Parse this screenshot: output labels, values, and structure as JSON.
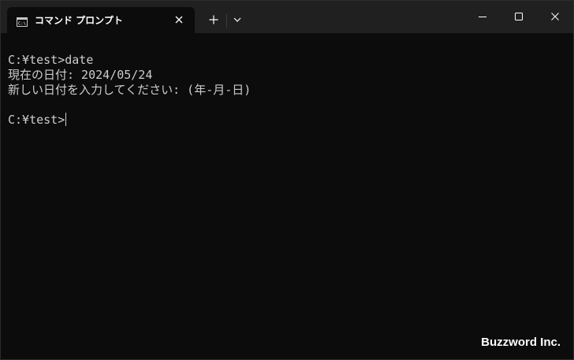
{
  "tab": {
    "title": "コマンド プロンプト"
  },
  "terminal": {
    "lines": [
      "C:¥test>date",
      "現在の日付: 2024/05/24",
      "新しい日付を入力してください: (年-月-日)",
      "",
      "C:¥test>"
    ]
  },
  "watermark": "Buzzword Inc.",
  "icons": {
    "tab_icon": "cmd-icon",
    "tab_close": "close-icon",
    "new_tab": "plus-icon",
    "dropdown": "chevron-down-icon",
    "minimize": "minimize-icon",
    "maximize": "maximize-icon",
    "close": "close-icon"
  },
  "colors": {
    "background": "#0c0c0c",
    "titlebar": "#202020",
    "text": "#cccccc"
  }
}
